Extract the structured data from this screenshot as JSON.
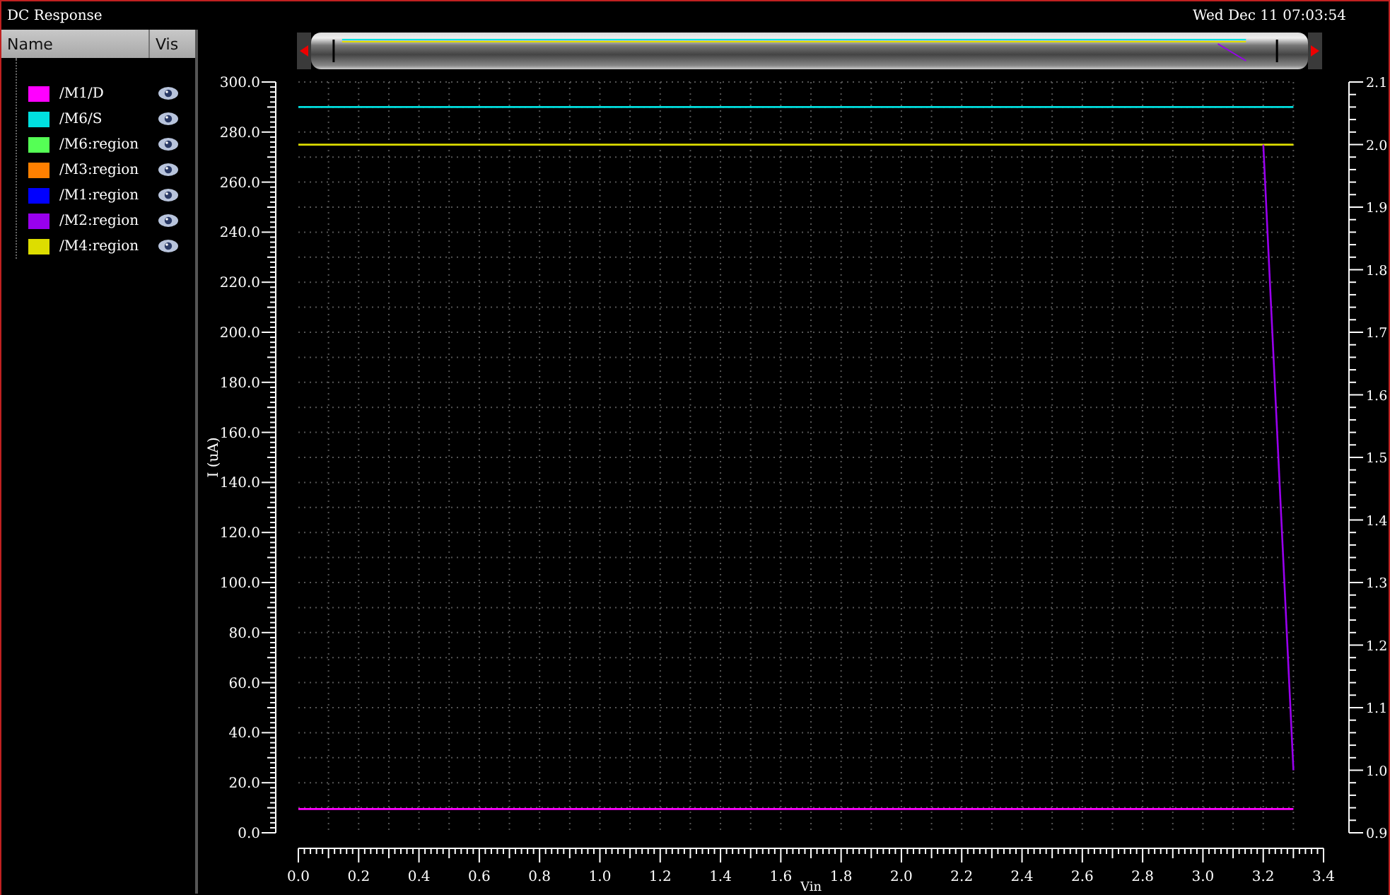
{
  "window": {
    "title": "DC Response",
    "timestamp": "Wed Dec 11 07:03:54"
  },
  "legend": {
    "columns": [
      "Name",
      "Vis"
    ],
    "items": [
      {
        "name": "/M1/D",
        "color": "#ff00ff",
        "visible": true
      },
      {
        "name": "/M6/S",
        "color": "#00e0e0",
        "visible": true
      },
      {
        "name": "/M6:region",
        "color": "#55ff55",
        "visible": true
      },
      {
        "name": "/M3:region",
        "color": "#ff8000",
        "visible": true
      },
      {
        "name": "/M1:region",
        "color": "#0000ff",
        "visible": true
      },
      {
        "name": "/M2:region",
        "color": "#9900ee",
        "visible": true
      },
      {
        "name": "/M4:region",
        "color": "#dddd00",
        "visible": true
      }
    ]
  },
  "plot": {
    "chart_data": {
      "type": "line",
      "xlabel": "Vin",
      "ylabel": "I (uA)",
      "x": [
        0,
        3.2,
        3.3
      ],
      "grid": true,
      "xlim": [
        0,
        3.4
      ],
      "ylim": [
        0,
        300
      ],
      "y2lim": [
        0.9,
        2.1
      ],
      "xticks": [
        {
          "value": 0,
          "label": "0.0"
        },
        {
          "value": 0.2,
          "label": "0.2"
        },
        {
          "value": 0.4,
          "label": "0.4"
        },
        {
          "value": 0.6,
          "label": "0.6"
        },
        {
          "value": 0.8,
          "label": "0.8"
        },
        {
          "value": 1,
          "label": "1.0"
        },
        {
          "value": 1.2,
          "label": "1.2"
        },
        {
          "value": 1.4,
          "label": "1.4"
        },
        {
          "value": 1.6,
          "label": "1.6"
        },
        {
          "value": 1.8,
          "label": "1.8"
        },
        {
          "value": 2,
          "label": "2.0"
        },
        {
          "value": 2.2,
          "label": "2.2"
        },
        {
          "value": 2.4,
          "label": "2.4"
        },
        {
          "value": 2.6,
          "label": "2.6"
        },
        {
          "value": 2.8,
          "label": "2.8"
        },
        {
          "value": 3,
          "label": "3.0"
        },
        {
          "value": 3.2,
          "label": "3.2"
        },
        {
          "value": 3.4,
          "label": "3.4"
        }
      ],
      "yticks": [
        {
          "value": 0,
          "label": "0.0"
        },
        {
          "value": 20,
          "label": "20.0"
        },
        {
          "value": 40,
          "label": "40.0"
        },
        {
          "value": 60,
          "label": "60.0"
        },
        {
          "value": 80,
          "label": "80.0"
        },
        {
          "value": 100,
          "label": "100.0"
        },
        {
          "value": 120,
          "label": "120.0"
        },
        {
          "value": 140,
          "label": "140.0"
        },
        {
          "value": 160,
          "label": "160.0"
        },
        {
          "value": 180,
          "label": "180.0"
        },
        {
          "value": 200,
          "label": "200.0"
        },
        {
          "value": 220,
          "label": "220.0"
        },
        {
          "value": 240,
          "label": "240.0"
        },
        {
          "value": 260,
          "label": "260.0"
        },
        {
          "value": 280,
          "label": "280.0"
        },
        {
          "value": 300,
          "label": "300.0"
        }
      ],
      "y2ticks": [
        {
          "value": 0.9,
          "label": "0.9"
        },
        {
          "value": 1.0,
          "label": "1.0"
        },
        {
          "value": 1.1,
          "label": "1.1"
        },
        {
          "value": 1.2,
          "label": "1.2"
        },
        {
          "value": 1.3,
          "label": "1.3"
        },
        {
          "value": 1.4,
          "label": "1.4"
        },
        {
          "value": 1.5,
          "label": "1.5"
        },
        {
          "value": 1.6,
          "label": "1.6"
        },
        {
          "value": 1.7,
          "label": "1.7"
        },
        {
          "value": 1.8,
          "label": "1.8"
        },
        {
          "value": 1.9,
          "label": "1.9"
        },
        {
          "value": 2.0,
          "label": "2.0"
        },
        {
          "value": 2.1,
          "label": "2.1"
        }
      ],
      "series": [
        {
          "color": "#ff00ff",
          "values": [
            9.5,
            9.5,
            9.5
          ]
        },
        {
          "color": "#00e0e0",
          "values": [
            290,
            290,
            290
          ]
        },
        {
          "color": "#dddd00",
          "axis": "y2",
          "values": [
            2.0,
            2.0,
            2.0
          ]
        },
        {
          "color": "#9900ee",
          "axis": "y2",
          "values": [
            null,
            2.0,
            1.0
          ]
        }
      ]
    }
  }
}
